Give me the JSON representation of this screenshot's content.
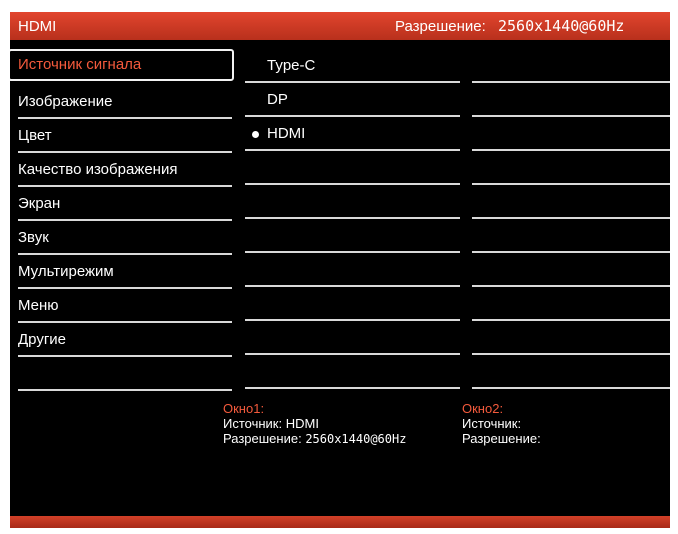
{
  "header": {
    "input_title": "HDMI",
    "resolution_label": "Разрешение:",
    "resolution_value": "2560x1440@60Hz"
  },
  "menu": [
    {
      "label": "Источник сигнала",
      "selected": true
    },
    {
      "label": "Изображение"
    },
    {
      "label": "Цвет"
    },
    {
      "label": "Качество изображения"
    },
    {
      "label": "Экран"
    },
    {
      "label": "Звук"
    },
    {
      "label": "Мультирежим"
    },
    {
      "label": "Меню"
    },
    {
      "label": "Другие"
    },
    {
      "label": ""
    }
  ],
  "submenu": [
    {
      "label": "Type-C",
      "active": false
    },
    {
      "label": "DP",
      "active": false
    },
    {
      "label": "HDMI",
      "active": true
    }
  ],
  "window1": {
    "title": "Окно1:",
    "source_label": "Источник:",
    "source_value": "HDMI",
    "resolution_label": "Разрешение:",
    "resolution_value": "2560x1440@60Hz"
  },
  "window2": {
    "title": "Окно2:",
    "source_label": "Источник:",
    "resolution_label": "Разрешение:"
  },
  "colors": {
    "accent": "#f45a3c",
    "bar": "#c83a24",
    "background": "#000000"
  }
}
